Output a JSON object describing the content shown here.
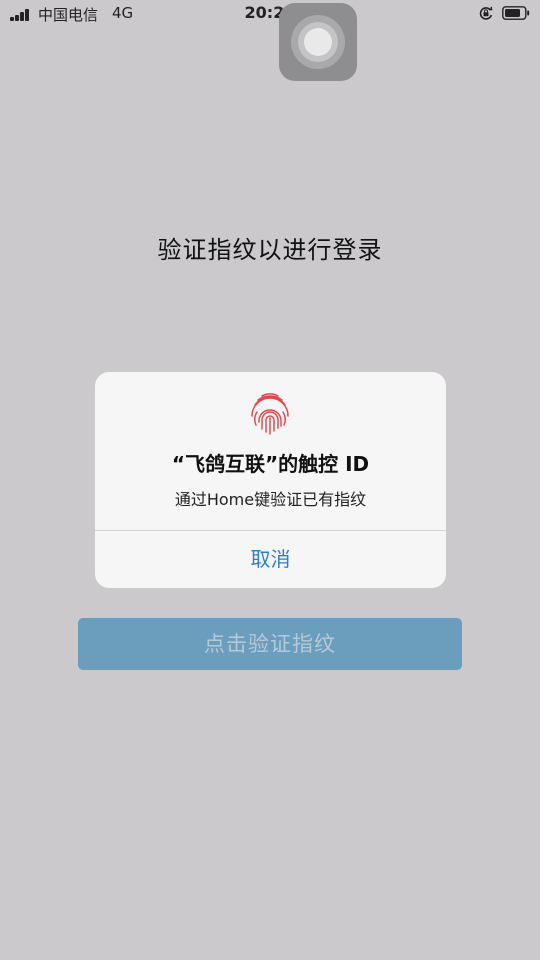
{
  "status_bar": {
    "carrier": "中国电信",
    "network": "4G",
    "time": "20:22"
  },
  "page": {
    "title": "验证指纹以进行登录"
  },
  "alert": {
    "title": "“飞鸽互联”的触控 ID",
    "message": "通过Home键验证已有指纹",
    "cancel_label": "取消",
    "accent_color": "#2a7fd4",
    "fingerprint_color": "#e5484d"
  },
  "verify_button": {
    "label": "点击验证指纹",
    "color": "#6b9dbd"
  },
  "icons": [
    "signal-icon",
    "rotation-lock-icon",
    "battery-icon",
    "assistive-touch-icon",
    "fingerprint-icon"
  ]
}
